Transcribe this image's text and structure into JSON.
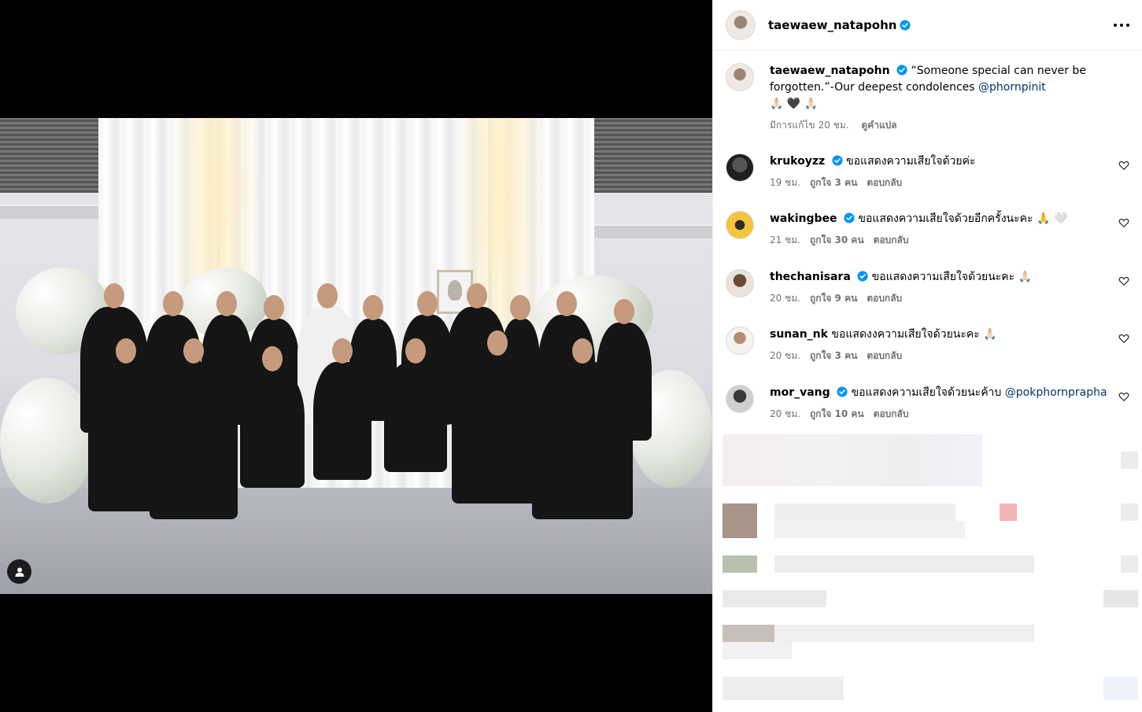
{
  "post": {
    "author": "taewaew_natapohn",
    "caption_author": "taewaew_natapohn",
    "caption_text_1": "“Someone special can never be forgotten.”-Our deepest condolences",
    "caption_mention": "@phornpinit",
    "caption_emojis": "🙏🏻 🖤 🙏🏻",
    "caption_edited": "มีการแก้ไข",
    "caption_time": "20 ชม.",
    "caption_translate": "ดูคำแปล"
  },
  "comments": [
    {
      "user": "krukoyzz",
      "text": "ขอแสดงความเสียใจด้วยค่ะ",
      "mention": "",
      "time": "19 ชม.",
      "likes": "ถูกใจ 3 คน",
      "reply": "ตอบกลับ"
    },
    {
      "user": "wakingbee",
      "text": "ขอแสดงความเสียใจด้วยอีกครั้งนะคะ 🙏 🤍",
      "mention": "",
      "time": "21 ชม.",
      "likes": "ถูกใจ 30 คน",
      "reply": "ตอบกลับ"
    },
    {
      "user": "thechanisara",
      "text": "ขอแสดงความเสียใจด้วยนะคะ 🙏🏻",
      "mention": "",
      "time": "20 ชม.",
      "likes": "ถูกใจ 9 คน",
      "reply": "ตอบกลับ"
    },
    {
      "user": "sunan_nk",
      "text": "ขอแสดงงความเสียใจด้วยนะคะ 🙏🏻",
      "mention": "",
      "time": "20 ชม.",
      "likes": "ถูกใจ 3 คน",
      "reply": "ตอบกลับ"
    },
    {
      "user": "mor_vang",
      "text": "ขอแสดงความเสียใจด้วยนะค้าบ",
      "mention": "@pokphornprapha",
      "time": "20 ชม.",
      "likes": "ถูกใจ 10 คน",
      "reply": "ตอบกลับ"
    }
  ],
  "icons": {
    "more": "more-options-icon",
    "verified": "verified-badge-icon",
    "heart": "heart-outline-icon",
    "user_tag": "user-tag-icon"
  },
  "colors": {
    "verified": "#0095f6",
    "mention": "#00376b",
    "meta": "#737373"
  }
}
